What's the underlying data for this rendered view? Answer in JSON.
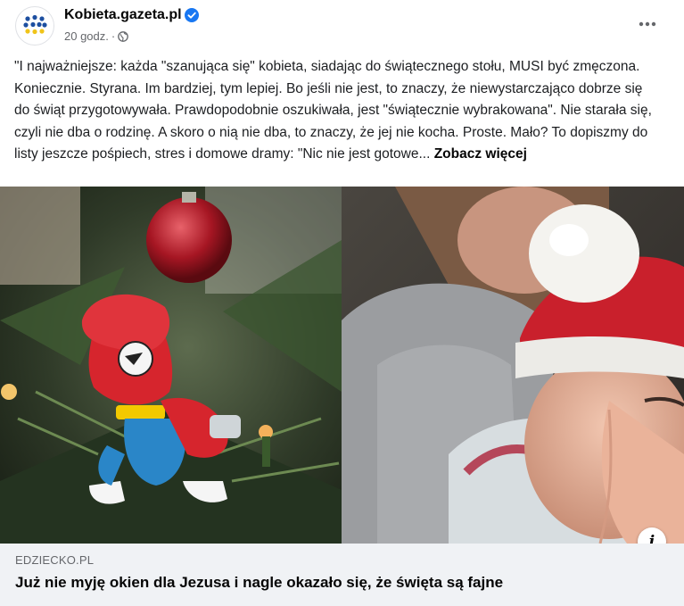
{
  "header": {
    "page_name": "Kobieta.gazeta.pl",
    "timestamp": "20 godz.",
    "separator": "·",
    "verified_icon": "verified-badge-icon",
    "privacy_icon": "globe-icon",
    "more_icon": "more-options-icon"
  },
  "post": {
    "text": "\"I najważniejsze: każda \"szanująca się\" kobieta, siadając do świątecznego stołu, MUSI być zmęczona. Koniecznie. Styrana. Im bardziej, tym lepiej. Bo jeśli nie jest, to znaczy, że niewystarczająco dobrze się do świąt przygotowywała. Prawdopodobnie oszukiwała, jest \"świątecznie wybrakowana\". Nie starała się, czyli nie dba o rodzinę. A skoro o nią nie dba, to znaczy, że jej nie kocha. Proste. Mało? To dopiszmy do listy jeszcze pośpiech, stres i domowe dramy: \"Nic nie jest gotowe...",
    "see_more": "Zobacz więcej"
  },
  "image": {
    "info_label": "i"
  },
  "link": {
    "domain": "EDZIECKO.PL",
    "title": "Już nie myję okien dla Jezusa i nagle okazało się, że święta są fajne"
  },
  "colors": {
    "brand_blue": "#1877f2",
    "secondary_text": "#65676b",
    "preview_bg": "#f0f2f5"
  }
}
